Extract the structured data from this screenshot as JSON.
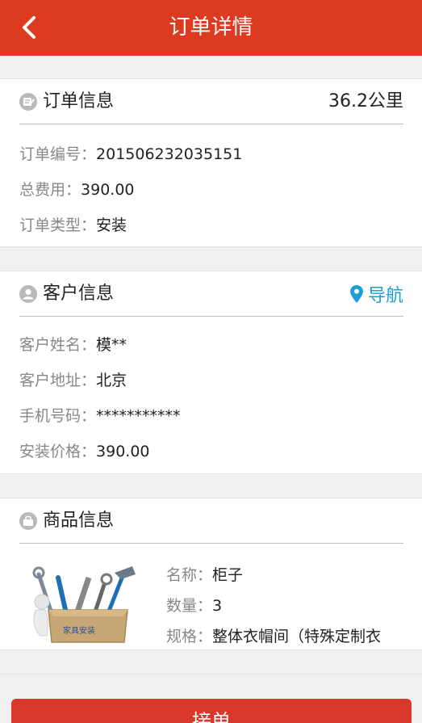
{
  "header": {
    "title": "订单详情",
    "back_icon": "chevron-left-icon"
  },
  "order": {
    "title": "订单信息",
    "distance": "36.2公里",
    "rows": [
      {
        "label": "订单编号：",
        "value": "201506232035151"
      },
      {
        "label": "总费用：",
        "value": "390.00"
      },
      {
        "label": "订单类型：",
        "value": "安装"
      }
    ]
  },
  "customer": {
    "title": "客户信息",
    "nav_label": "导航",
    "rows": [
      {
        "label": "客户姓名：",
        "value": "模**"
      },
      {
        "label": "客户地址：",
        "value": "北京"
      },
      {
        "label": "手机号码：",
        "value": "***********"
      },
      {
        "label": "安装价格：",
        "value": "390.00"
      }
    ]
  },
  "goods": {
    "title": "商品信息",
    "image_caption": "家具安装",
    "rows": [
      {
        "label": "名称：",
        "value": "柜子"
      },
      {
        "label": "数量：",
        "value": "3"
      },
      {
        "label": "规格：",
        "value": "整体衣帽间（特殊定制衣"
      }
    ]
  },
  "footer": {
    "accept_label": "接单"
  },
  "colors": {
    "brand": "#dd3b1f",
    "nav": "#1aa0d6",
    "button": "#d8382a"
  }
}
